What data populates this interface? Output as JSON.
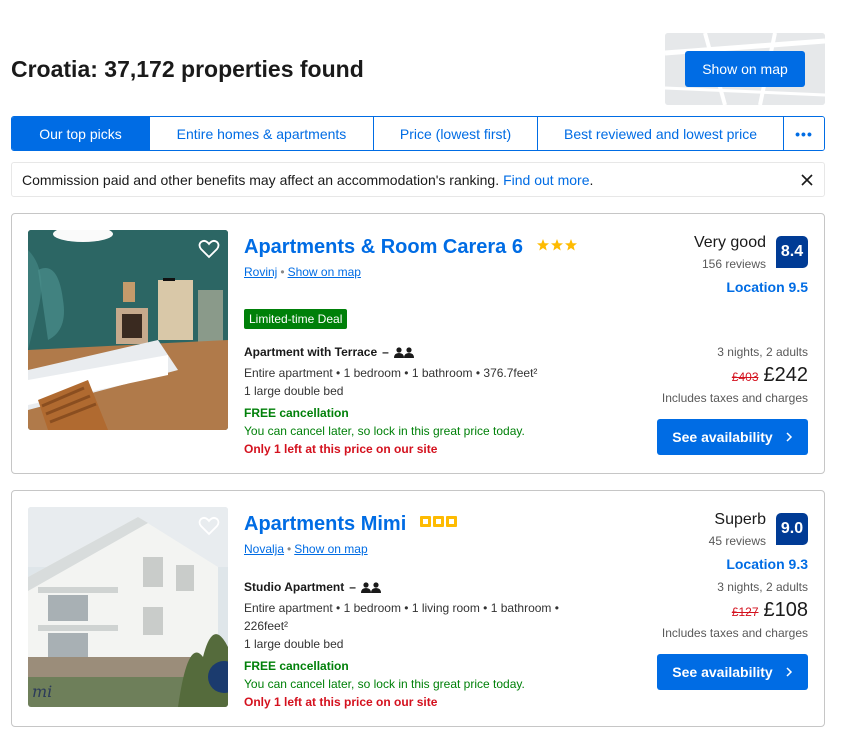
{
  "header": {
    "title": "Croatia: 37,172 properties found",
    "map_button": "Show on map"
  },
  "tabs": [
    {
      "label": "Our top picks",
      "active": true
    },
    {
      "label": "Entire homes & apartments",
      "active": false
    },
    {
      "label": "Price (lowest first)",
      "active": false
    },
    {
      "label": "Best reviewed and lowest price",
      "active": false
    }
  ],
  "tab_more": "•••",
  "notice": {
    "text": "Commission paid and other benefits may affect an accommodation's ranking.",
    "link": "Find out more",
    "suffix": "."
  },
  "properties": [
    {
      "name": "Apartments & Room Carera 6",
      "location": "Rovinj",
      "map_link": "Show on map",
      "deal_badge": "Limited-time Deal",
      "room_type": "Apartment with Terrace",
      "room_dash": "–",
      "details_line1": "Entire apartment • 1 bedroom • 1 bathroom • 376.7feet²",
      "details_line2": "1 large double bed",
      "free_cancellation": "FREE cancellation",
      "cancel_text": "You can cancel later, so lock in this great price today.",
      "scarcity": "Only 1 left at this price on our site",
      "rating_word": "Very good",
      "reviews": "156 reviews",
      "score": "8.4",
      "location_score": "Location 9.5",
      "stay": "3 nights, 2 adults",
      "old_price": "£403",
      "price": "£242",
      "taxes": "Includes taxes and charges",
      "button": "See availability"
    },
    {
      "name": "Apartments Mimi",
      "location": "Novalja",
      "map_link": "Show on map",
      "room_type": "Studio Apartment",
      "room_dash": "–",
      "details_line1": "Entire apartment • 1 bedroom • 1 living room • 1 bathroom •",
      "details_line2": "226feet²",
      "details_line3": "1 large double bed",
      "free_cancellation": "FREE cancellation",
      "cancel_text": "You can cancel later, so lock in this great price today.",
      "scarcity": "Only 1 left at this price on our site",
      "rating_word": "Superb",
      "reviews": "45 reviews",
      "score": "9.0",
      "location_score": "Location 9.3",
      "stay": "3 nights, 2 adults",
      "old_price": "£127",
      "price": "£108",
      "taxes": "Includes taxes and charges",
      "button": "See availability",
      "photo_watermark": "mi"
    }
  ],
  "colors": {
    "brand_blue": "#006ce4",
    "score_navy": "#003b95",
    "green": "#008009",
    "red": "#d4111e",
    "star_yellow": "#febb02"
  }
}
